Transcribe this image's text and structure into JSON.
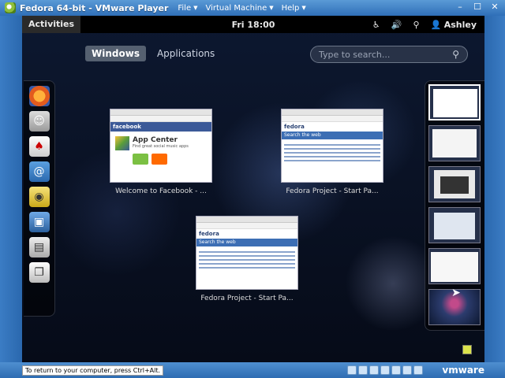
{
  "vm": {
    "title": "Fedora 64-bit - VMware Player",
    "menus": [
      "File",
      "Virtual Machine",
      "Help"
    ],
    "status_hint": "To return to your computer, press Ctrl+Alt.",
    "logo": "vmware"
  },
  "topbar": {
    "activities": "Activities",
    "clock": "Fri 18:00",
    "user": "Ashley"
  },
  "overview": {
    "tabs": [
      "Windows",
      "Applications"
    ],
    "search_placeholder": "Type to search..."
  },
  "dash": [
    "firefox-icon",
    "empathy-icon",
    "solitaire-icon",
    "contacts-icon",
    "rhythmbox-icon",
    "shotwell-icon",
    "files-icon",
    "documents-icon"
  ],
  "windows": [
    {
      "caption": "Welcome to Facebook - ...",
      "app_title": "App Center",
      "app_sub": "Find great social music apps",
      "site": "facebook"
    },
    {
      "caption": "Fedora Project - Start Pa...",
      "site": "fedora",
      "banner": "Search the web"
    },
    {
      "caption": "Fedora Project - Start Pa...",
      "site": "fedora",
      "banner": "Search the web"
    }
  ],
  "colors": {
    "accent": "#3b5998",
    "fedora": "#3c6eb4"
  }
}
